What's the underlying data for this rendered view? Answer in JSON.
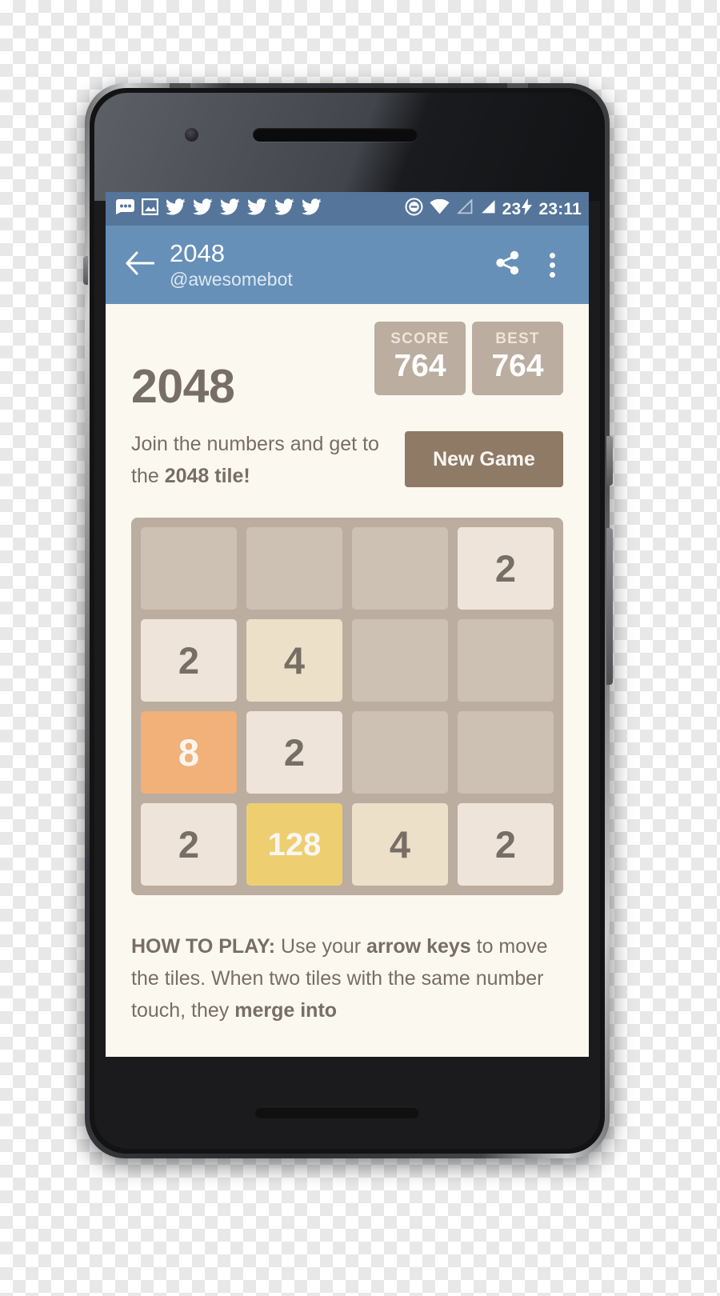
{
  "status_bar": {
    "icons": [
      "messages-icon",
      "image-icon",
      "twitter-icon",
      "twitter-icon",
      "twitter-icon",
      "twitter-icon",
      "twitter-icon",
      "twitter-icon"
    ],
    "dnd_icon": "do-not-disturb-icon",
    "wifi_icon": "wifi-icon",
    "signal_empty_icon": "signal-empty-icon",
    "signal_full_icon": "signal-full-icon",
    "battery_percent": "23",
    "charging_icon": "lightning-bolt-icon",
    "clock": "23:11",
    "background_color": "#55759b"
  },
  "app_bar": {
    "back_icon": "back-arrow-icon",
    "title": "2048",
    "subtitle": "@awesomebot",
    "share_icon": "share-icon",
    "overflow_icon": "overflow-menu-icon",
    "background_color": "#6690b8"
  },
  "game": {
    "title": "2048",
    "score": {
      "label": "SCORE",
      "value": "764"
    },
    "best": {
      "label": "BEST",
      "value": "764"
    },
    "tagline_part1": "Join the numbers and get to the ",
    "tagline_bold": "2048 tile!",
    "new_game_label": "New Game",
    "board": {
      "rows": [
        [
          "",
          "",
          "",
          "2"
        ],
        [
          "2",
          "4",
          "",
          ""
        ],
        [
          "8",
          "2",
          "",
          ""
        ],
        [
          "2",
          "128",
          "4",
          "2"
        ]
      ]
    },
    "how_to_play": {
      "lead": "HOW TO PLAY:",
      "text_a": " Use your ",
      "bold_a": "arrow keys",
      "text_b": " to move the tiles. When two tiles with the same number touch, they ",
      "bold_b": "merge into"
    },
    "colors": {
      "page_background": "#faf8ef",
      "board_background": "#bbada0",
      "empty_cell": "#cdc1b4",
      "tile_2": "#eee4da",
      "tile_4": "#ede0c8",
      "tile_8": "#f2b179",
      "tile_128": "#edcf72",
      "text_dark": "#776e65",
      "new_game": "#8f7a66"
    }
  }
}
